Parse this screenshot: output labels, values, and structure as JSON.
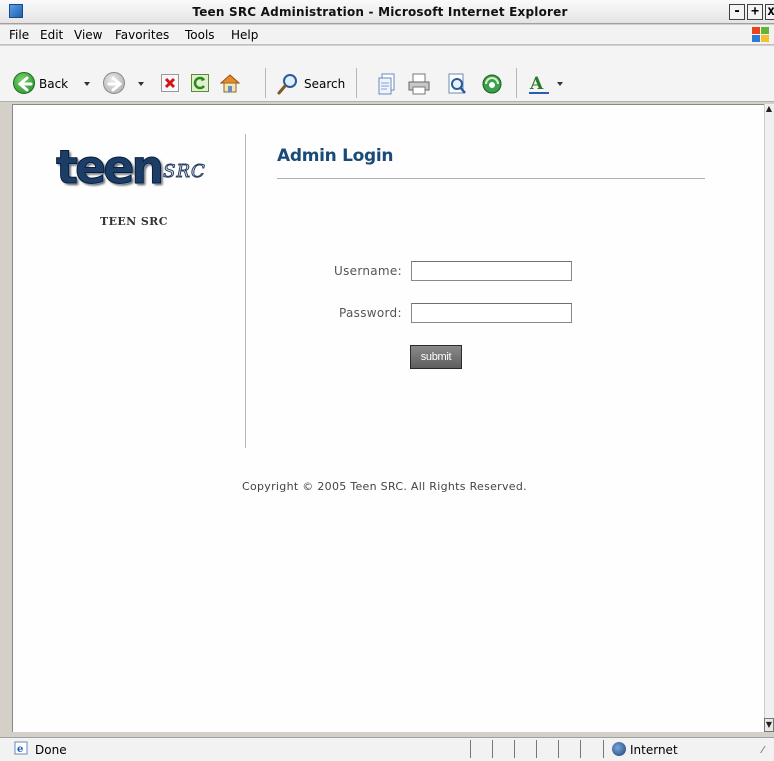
{
  "window": {
    "title": "Teen SRC Administration - Microsoft Internet Explorer",
    "minimize": "-",
    "maximize": "+",
    "close": "x"
  },
  "menu": [
    "File",
    "Edit",
    "View",
    "Favorites",
    "Tools",
    "Help"
  ],
  "toolbar": {
    "back_label": "Back",
    "search_label": "Search",
    "icons": [
      "back-icon",
      "forward-icon",
      "stop-icon",
      "refresh-icon",
      "home-icon",
      "search-icon",
      "history-icon",
      "print-icon",
      "preview-icon",
      "media-icon",
      "font-icon"
    ]
  },
  "page": {
    "logo_main": "teen",
    "logo_sub": "SRC",
    "site_name": "TEEN SRC",
    "heading": "Admin Login",
    "username_label": "Username:",
    "password_label": "Password:",
    "username_value": "",
    "password_value": "",
    "submit_label": "submit",
    "copyright": "Copyright © 2005 Teen SRC. All Rights Reserved."
  },
  "status": {
    "text": "Done",
    "zone": "Internet"
  },
  "colors": {
    "heading": "#1a4a78",
    "logo": "#1c3e66"
  }
}
